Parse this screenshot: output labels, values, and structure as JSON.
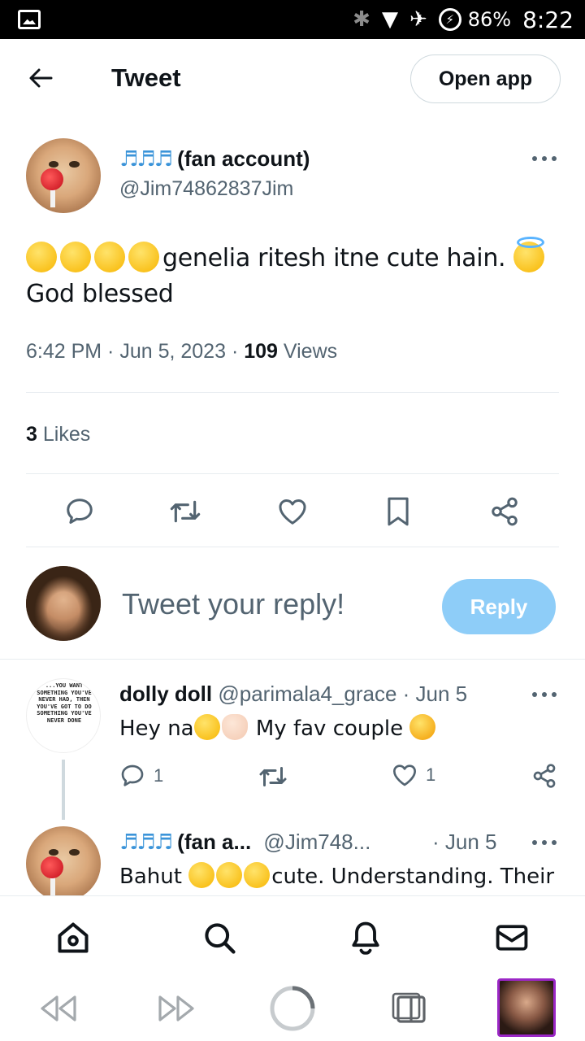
{
  "status_bar": {
    "battery": "86%",
    "time": "8:22"
  },
  "header": {
    "title": "Tweet",
    "open_app_label": "Open app"
  },
  "tweet": {
    "author_notes": "♬♬♬",
    "author_suffix": "(fan account)",
    "handle": "@Jim74862837Jim",
    "text": "genelia ritesh itne cute hain.",
    "text_line2": "God blessed",
    "time": "6:42 PM",
    "date": "Jun 5, 2023",
    "views_count": "109",
    "views_label": "Views",
    "likes_count": "3",
    "likes_label": "Likes"
  },
  "compose": {
    "placeholder": "Tweet your reply!",
    "reply_label": "Reply"
  },
  "replies": [
    {
      "name": "dolly doll",
      "handle": "@parimala4_grace",
      "date": "· Jun 5",
      "text_a": "Hey na",
      "text_b": "My fav couple",
      "reply_count": "1",
      "like_count": "1",
      "avatar_text": "...YOU WANT SOMETHING YOU'VE NEVER HAD, THEN YOU'VE GOT TO DO SOMETHING YOU'VE NEVER DONE"
    },
    {
      "name_notes": "♬♬♬",
      "name_suffix": "(fan a...",
      "handle": "@Jim748...",
      "date": "· Jun 5",
      "text_a": "Bahut",
      "text_b": "cute. Understanding. Their"
    }
  ],
  "icons": {
    "back": "arrow-left-icon",
    "reply": "comment-icon",
    "retweet": "retweet-icon",
    "like": "heart-icon",
    "bookmark": "bookmark-icon",
    "share": "share-icon",
    "home": "home-icon",
    "search": "search-icon",
    "notifications": "bell-icon",
    "messages": "mail-icon"
  },
  "colors": {
    "accent": "#1d9bf0",
    "reply_button": "#8ecdf8",
    "muted": "#536471"
  }
}
